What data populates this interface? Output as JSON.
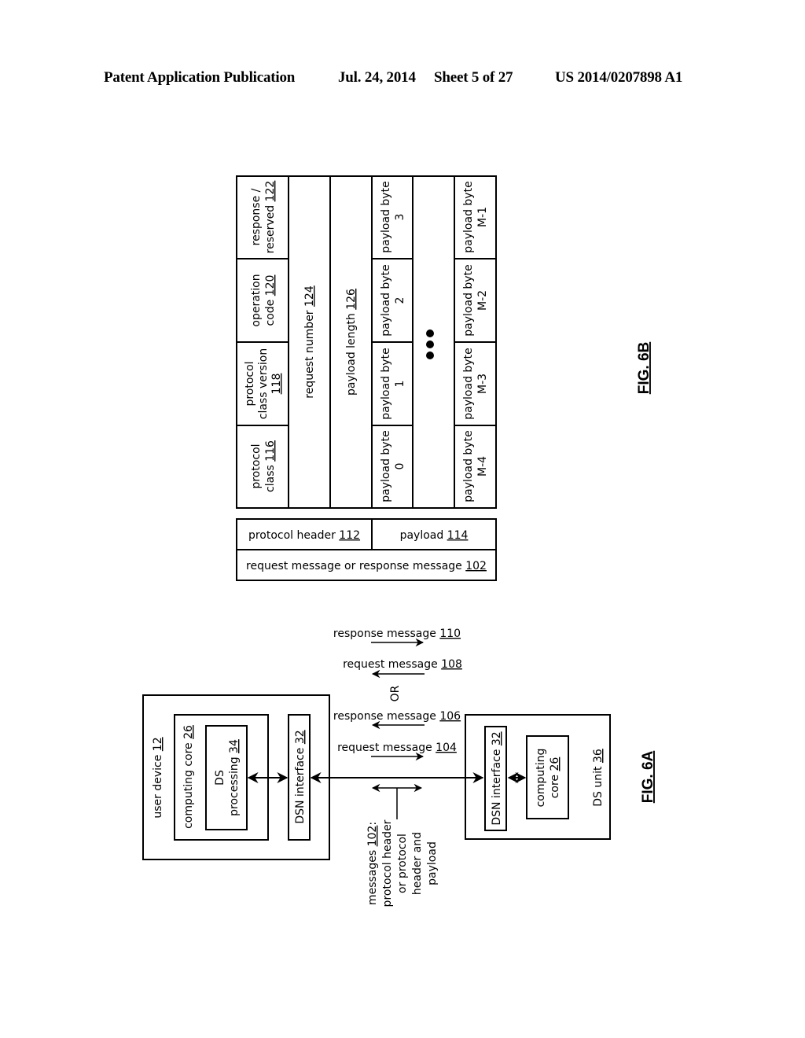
{
  "header": {
    "left": "Patent Application Publication",
    "date": "Jul. 24, 2014",
    "sheet": "Sheet 5 of 27",
    "number": "US 2014/0207898 A1"
  },
  "fig6b": {
    "caption": "FIG. 6B",
    "header_fields": [
      {
        "lines": [
          "protocol",
          "class "
        ],
        "ref": "116"
      },
      {
        "lines": [
          "protocol",
          "class version"
        ],
        "ref": "118"
      },
      {
        "lines": [
          "operation",
          "code "
        ],
        "ref": "120"
      },
      {
        "lines": [
          "response /",
          "reserved "
        ],
        "ref": "122"
      }
    ],
    "request_number": {
      "text": "request number ",
      "ref": "124"
    },
    "payload_length": {
      "text": "payload length ",
      "ref": "126"
    },
    "payload_bytes_first": [
      {
        "line1": "payload byte",
        "line2": "0"
      },
      {
        "line1": "payload byte",
        "line2": "1"
      },
      {
        "line1": "payload byte",
        "line2": "2"
      },
      {
        "line1": "payload byte",
        "line2": "3"
      }
    ],
    "payload_bytes_last": [
      {
        "line1": "payload byte",
        "line2": "M-4"
      },
      {
        "line1": "payload byte",
        "line2": "M-3"
      },
      {
        "line1": "payload byte",
        "line2": "M-2"
      },
      {
        "line1": "payload byte",
        "line2": "M-1"
      }
    ],
    "ellipsis": "●●●",
    "message_structure": {
      "protocol_header": {
        "text": "protocol header ",
        "ref": "112"
      },
      "payload": {
        "text": "payload ",
        "ref": "114"
      },
      "message": {
        "text": "request or response message ",
        "ref": "102"
      }
    }
  },
  "fig6a": {
    "caption": "FIG. 6A",
    "user_device": {
      "text": "user device ",
      "ref": "12"
    },
    "computing_core": {
      "text": "computing core ",
      "ref": "26"
    },
    "ds_processing": {
      "line1": "DS",
      "line2": "processing ",
      "ref": "34"
    },
    "dsn_interface_left": {
      "text": "DSN interface ",
      "ref": "32"
    },
    "dsn_interface_right": {
      "text": "DSN interface ",
      "ref": "32"
    },
    "ds_computing_core": {
      "line1": "computing",
      "line2": "core ",
      "ref": "26"
    },
    "ds_unit": {
      "text": "DS unit ",
      "ref": "36"
    },
    "messages": [
      {
        "text": "response message ",
        "ref": "110",
        "direction": "right"
      },
      {
        "text": "request message ",
        "ref": "108",
        "direction": "left"
      },
      {
        "text": "response message ",
        "ref": "106",
        "direction": "left"
      },
      {
        "text": "request message ",
        "ref": "104",
        "direction": "right"
      }
    ],
    "or_label": "OR",
    "messages_note": {
      "lines": [
        "messages ",
        "protocol header",
        "or protocol",
        "header and",
        "payload"
      ],
      "ref": "102",
      "suffix": ":"
    }
  }
}
